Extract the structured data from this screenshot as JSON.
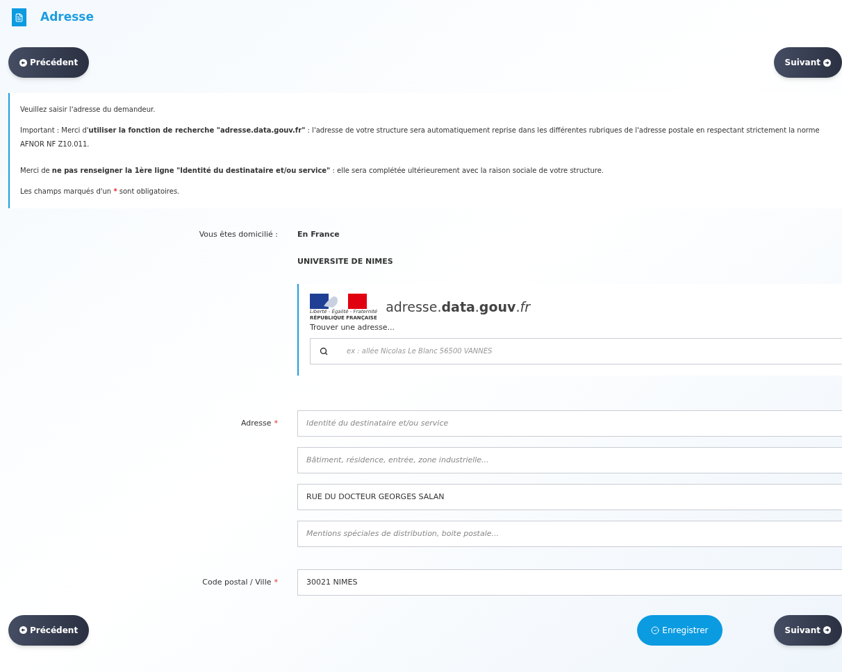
{
  "header": {
    "title": "Adresse"
  },
  "nav_top": {
    "previous": "Précédent",
    "next": "Suivant"
  },
  "info": {
    "paragraphs": [
      "Veuillez saisir l'adresse du demandeur.",
      "Important : Merci d'**utiliser la fonction de recherche \"adresse.data.gouv.fr\"** : l'adresse de votre structure sera automatiquement reprise dans les différentes rubriques de l'adresse postale en respectant strictement la norme AFNOR NF  Z10.011.",
      "Merci de **ne pas renseigner la 1ère ligne \"Identité du destinataire et/ou service\"** : elle sera complétée ultérieurement avec la raison sociale de votre structure.",
      "Les champs marqués d'un * sont obligatoires."
    ]
  },
  "domicile": {
    "label": "Vous êtes domicilié :",
    "value": "En France"
  },
  "organisation": "UNIVERSITE DE NIMES",
  "required_mark": "*",
  "search_widget": {
    "motto": "Liberté - Égalité - Fraternité",
    "republic": "RÉPUBLIQUE FRANÇAISE",
    "brand": "adresse.**data**.**gouv**.*fr*",
    "prompt": "Trouver une adresse...",
    "placeholder": "ex : allée Nicolas Le Blanc 56500 VANNES"
  },
  "address": {
    "label": "Adresse",
    "required": true,
    "lines": [
      {
        "placeholder": "Identité du destinataire et/ou service"
      },
      {
        "placeholder": "Bâtiment, résidence, entrée, zone industrielle..."
      },
      {
        "value": "RUE DU DOCTEUR GEORGES SALAN"
      },
      {
        "placeholder": "Mentions spéciales de distribution, boite postale..."
      }
    ]
  },
  "city": {
    "label": "Code postal / Ville",
    "required": true,
    "value": "30021 NIMES"
  },
  "nav_bottom": {
    "previous": "Précédent",
    "save": "Enregistrer",
    "next": "Suivant"
  }
}
